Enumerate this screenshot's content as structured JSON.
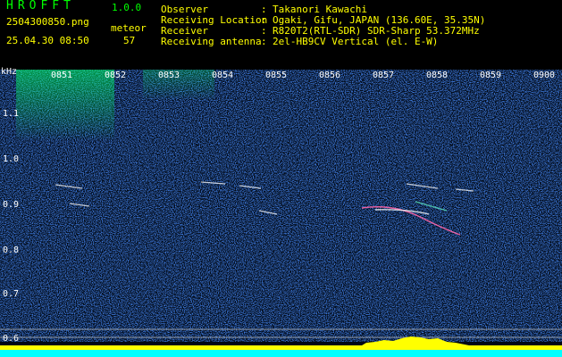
{
  "header": {
    "app_title": "HROFFT",
    "app_version": "1.0.0",
    "filename": "2504300850.png",
    "datetime": "25.04.30 08:50",
    "meteor_label": "meteor",
    "meteor_count": "57"
  },
  "info": [
    {
      "label": "Observer",
      "value": "Takanori Kawachi"
    },
    {
      "label": "Receiving Location",
      "value": "Ogaki, Gifu, JAPAN (136.60E, 35.35N)"
    },
    {
      "label": "Receiver",
      "value": "R820T2(RTL-SDR) SDR-Sharp 53.372MHz"
    },
    {
      "label": "Receiving antenna",
      "value": "2el-HB9CV Vertical (el. E-W)"
    }
  ],
  "colon": ":",
  "axis": {
    "unit": "kHz",
    "y_ticks": [
      "1.1",
      "1.0",
      "0.9",
      "0.8",
      "0.7",
      "0.6"
    ],
    "x_ticks": [
      "0851",
      "0852",
      "0853",
      "0854",
      "0855",
      "0856",
      "0857",
      "0858",
      "0859",
      "0900"
    ]
  },
  "colors": {
    "background": "#000000",
    "header_green": "#00ff00",
    "header_yellow": "#ffff00",
    "noise_blue": "#1a3a9a",
    "meteor_trace": "#ff66aa",
    "level_bar": "#ffff00",
    "baseline": "#00ffff"
  }
}
